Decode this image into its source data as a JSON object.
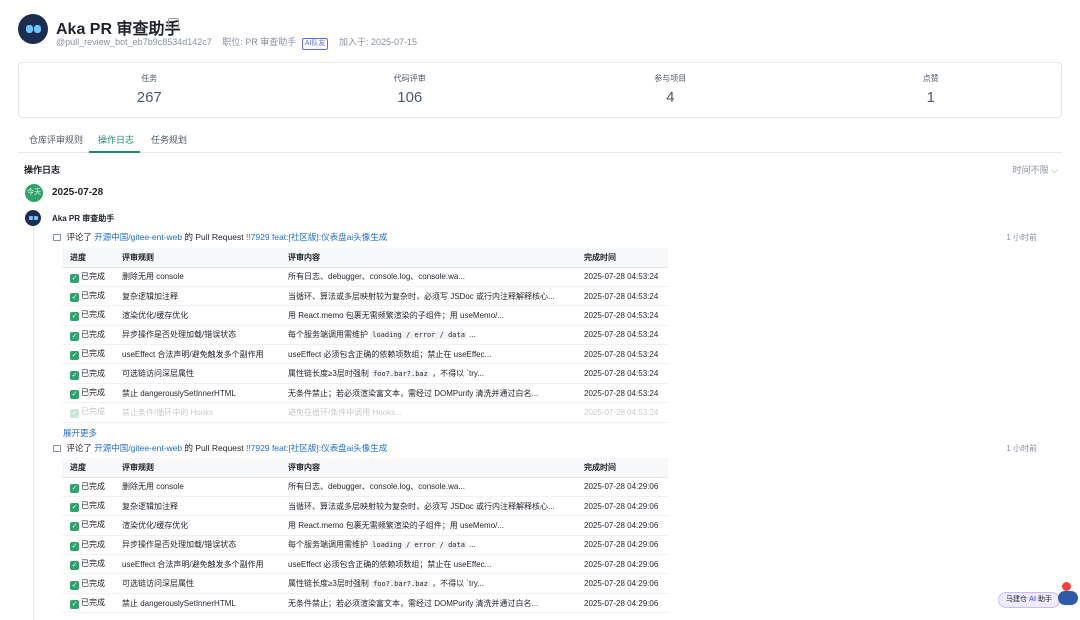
{
  "header": {
    "name": "Aka PR 审查助手",
    "handle": "@pull_review_bot_eb7b9c8534d142c7",
    "role": "职位: PR 审查助手",
    "badge": "AI队友",
    "joined": "加入于: 2025-07-15"
  },
  "stats": [
    {
      "label": "任务",
      "value": "267"
    },
    {
      "label": "代码评审",
      "value": "106"
    },
    {
      "label": "参与项目",
      "value": "4"
    },
    {
      "label": "点赞",
      "value": "1"
    }
  ],
  "tabs": [
    "仓库评审规则",
    "操作日志",
    "任务规划"
  ],
  "active_tab": "操作日志",
  "section_title": "操作日志",
  "time_filter": "时间不限",
  "timeline": {
    "today_badge": "今天",
    "date": "2025-07-28",
    "actor": "Aka PR 审查助手"
  },
  "comment": {
    "verb": "评论了",
    "repo": "开源中国/gitee-ent-web",
    "middle": "的 Pull Request",
    "pr": "!!7929 feat:[社区版]:仪表盘ai头像生成",
    "ago": "1 小时前"
  },
  "table_headers": [
    "进度",
    "评审规则",
    "评审内容",
    "完成时间"
  ],
  "status_done": "已完成",
  "rules": [
    {
      "rule": "删除无用 console",
      "content": "所有日志、debugger、console.log、console.wa..."
    },
    {
      "rule": "复杂逻辑加注释",
      "content": "当循环、算法或多层映射较为复杂时，必须写 JSDoc 或行内注释解释核心..."
    },
    {
      "rule": "渲染优化/缓存优化",
      "content": "用 React.memo 包裹无需频繁渲染的子组件；用 useMemo/..."
    },
    {
      "rule": "异步操作是否处理加载/错误状态",
      "content_pre": "每个服务端调用需维护 ",
      "code": "loading / error / data",
      "content_post": " ..."
    },
    {
      "rule": "useEffect 合法声明/避免触发多个副作用",
      "content": "useEffect 必须包含正确的依赖项数组；禁止在 useEffec..."
    },
    {
      "rule": "可选链访问深层属性",
      "content_pre": "属性链长度≥3层时强制 ",
      "code": "foo?.bar?.baz",
      "content_post": " ，不得以 `try..."
    },
    {
      "rule": "禁止 dangerouslySetInnerHTML",
      "content": "无条件禁止；若必须渲染富文本，需经过 DOMPurify 清洗并通过白名..."
    },
    {
      "rule": "禁止条件/循环中的 Hooks",
      "content": "避免在循环/条件中调用 Hooks..."
    }
  ],
  "log1_time": "2025-07-28 04:53:24",
  "log2_time": "2025-07-28 04:29:06",
  "expand_more": "展开更多",
  "assistant": {
    "name": "马建仓",
    "ai": "AI",
    "suffix": "助手"
  }
}
